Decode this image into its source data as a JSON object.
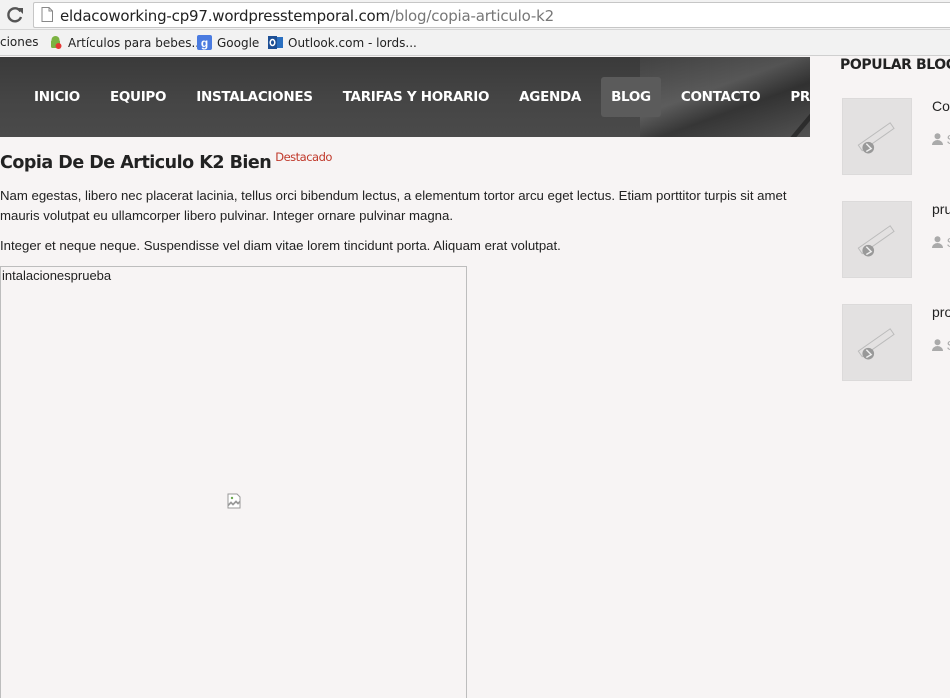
{
  "browser": {
    "url_host": "eldacoworking-cp97.wordpresstemporal.com",
    "url_path": "/blog/copia-articulo-k2",
    "bookmarks": [
      {
        "label": "ciones",
        "icon": "none"
      },
      {
        "label": "Artículos para bebes...",
        "icon": "android-icon"
      },
      {
        "label": "Google",
        "icon": "google-icon"
      },
      {
        "label": "Outlook.com - lords...",
        "icon": "outlook-icon"
      }
    ]
  },
  "nav": {
    "items": [
      "INICIO",
      "EQUIPO",
      "INSTALACIONES",
      "TARIFAS Y HORARIO",
      "AGENDA",
      "BLOG",
      "CONTACTO",
      "PRUEBA"
    ],
    "active": "BLOG"
  },
  "article": {
    "title": "Copia De De Articulo K2 Bien",
    "badge": "Destacado",
    "paragraph1": "Nam egestas, libero nec placerat lacinia, tellus orci bibendum lectus, a elementum tortor arcu eget lectus. Etiam porttitor turpis sit amet mauris volutpat eu ullamcorper libero pulvinar. Integer ornare pulvinar magna.",
    "paragraph2": "Integer et neque neque. Suspendisse vel diam vitae lorem tincidunt porta. Aliquam erat volutpat.",
    "image_alt": "intalacionesprueba"
  },
  "sidebar": {
    "title": "POPULAR BLOG P",
    "posts": [
      {
        "title": "Co",
        "meta": "S"
      },
      {
        "title": "pru",
        "meta": "S"
      },
      {
        "title": "pro",
        "meta": "S"
      }
    ]
  },
  "colors": {
    "page_bg": "#f7f4f4",
    "header_bg": "#444444",
    "nav_active_bg": "#5b5b5b",
    "badge": "#c0392b"
  }
}
